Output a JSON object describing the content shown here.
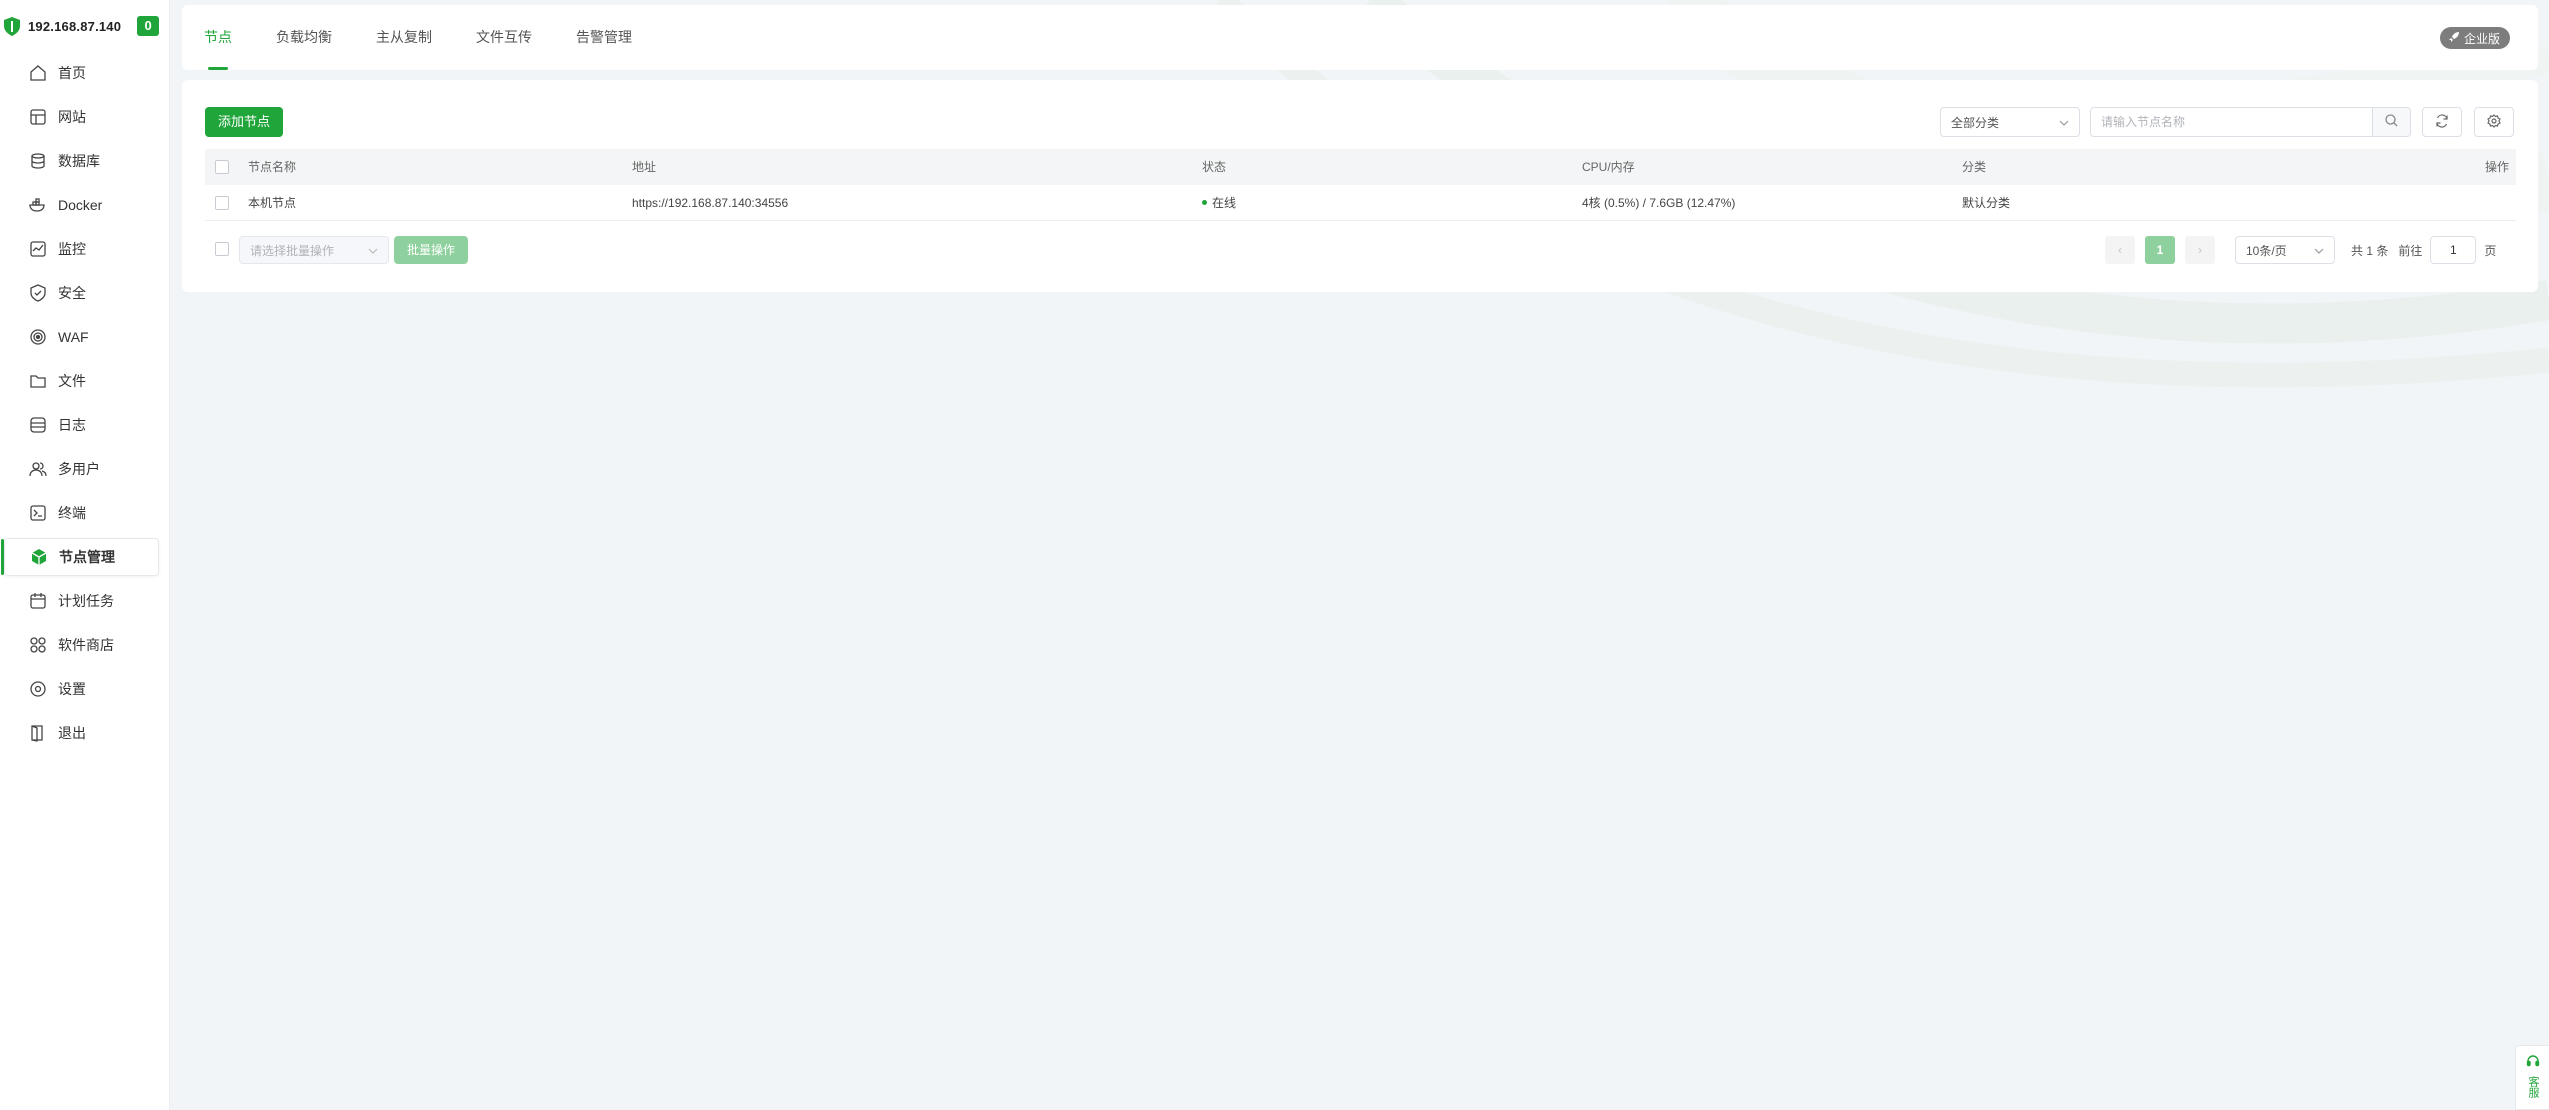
{
  "sidebar": {
    "server_ip": "192.168.87.140",
    "badge_count": "0",
    "items": [
      {
        "label": "首页",
        "icon": "home-icon"
      },
      {
        "label": "网站",
        "icon": "website-icon"
      },
      {
        "label": "数据库",
        "icon": "database-icon"
      },
      {
        "label": "Docker",
        "icon": "docker-icon"
      },
      {
        "label": "监控",
        "icon": "monitor-icon"
      },
      {
        "label": "安全",
        "icon": "shield-icon"
      },
      {
        "label": "WAF",
        "icon": "waf-icon"
      },
      {
        "label": "文件",
        "icon": "folder-icon"
      },
      {
        "label": "日志",
        "icon": "log-icon"
      },
      {
        "label": "多用户",
        "icon": "users-icon"
      },
      {
        "label": "终端",
        "icon": "terminal-icon"
      },
      {
        "label": "节点管理",
        "icon": "node-icon",
        "active": true
      },
      {
        "label": "计划任务",
        "icon": "calendar-icon"
      },
      {
        "label": "软件商店",
        "icon": "apps-icon"
      },
      {
        "label": "设置",
        "icon": "gear-icon"
      },
      {
        "label": "退出",
        "icon": "logout-icon"
      }
    ]
  },
  "tabs": [
    {
      "label": "节点",
      "active": true
    },
    {
      "label": "负载均衡"
    },
    {
      "label": "主从复制"
    },
    {
      "label": "文件互传"
    },
    {
      "label": "告警管理"
    }
  ],
  "enterprise_badge": "企业版",
  "toolbar": {
    "add_node_label": "添加节点",
    "category_value": "全部分类",
    "search_placeholder": "请输入节点名称"
  },
  "table": {
    "headers": {
      "name": "节点名称",
      "address": "地址",
      "status": "状态",
      "cpu_mem": "CPU/内存",
      "category": "分类",
      "actions": "操作"
    },
    "rows": [
      {
        "name": "本机节点",
        "address": "https://192.168.87.140:34556",
        "status": "在线",
        "cpu_mem": "4核 (0.5%) / 7.6GB (12.47%)",
        "category": "默认分类"
      }
    ]
  },
  "footer": {
    "batch_placeholder": "请选择批量操作",
    "batch_button": "批量操作",
    "prev": "‹",
    "current_page": "1",
    "next": "›",
    "page_size": "10条/页",
    "total": "共 1 条",
    "goto_label": "前往",
    "goto_value": "1",
    "page_suffix": "页"
  },
  "customer_service": "客服",
  "colors": {
    "accent": "#20a53a",
    "accent_light": "#8fd19e",
    "badge_gray": "#7d7d7d"
  }
}
